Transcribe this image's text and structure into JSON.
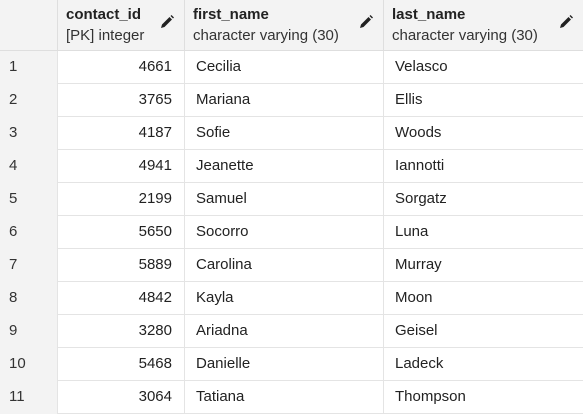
{
  "columns": [
    {
      "name": "contact_id",
      "type": "[PK] integer"
    },
    {
      "name": "first_name",
      "type": "character varying (30)"
    },
    {
      "name": "last_name",
      "type": "character varying (30)"
    }
  ],
  "rows": [
    {
      "num": "1",
      "contact_id": "4661",
      "first_name": "Cecilia",
      "last_name": "Velasco"
    },
    {
      "num": "2",
      "contact_id": "3765",
      "first_name": "Mariana",
      "last_name": "Ellis"
    },
    {
      "num": "3",
      "contact_id": "4187",
      "first_name": "Sofie",
      "last_name": "Woods"
    },
    {
      "num": "4",
      "contact_id": "4941",
      "first_name": "Jeanette",
      "last_name": "Iannotti"
    },
    {
      "num": "5",
      "contact_id": "2199",
      "first_name": "Samuel",
      "last_name": "Sorgatz"
    },
    {
      "num": "6",
      "contact_id": "5650",
      "first_name": "Socorro",
      "last_name": "Luna"
    },
    {
      "num": "7",
      "contact_id": "5889",
      "first_name": "Carolina",
      "last_name": "Murray"
    },
    {
      "num": "8",
      "contact_id": "4842",
      "first_name": "Kayla",
      "last_name": "Moon"
    },
    {
      "num": "9",
      "contact_id": "3280",
      "first_name": "Ariadna",
      "last_name": "Geisel"
    },
    {
      "num": "10",
      "contact_id": "5468",
      "first_name": "Danielle",
      "last_name": "Ladeck"
    },
    {
      "num": "11",
      "contact_id": "3064",
      "first_name": "Tatiana",
      "last_name": "Thompson"
    }
  ],
  "icons": {
    "edit": "pencil-icon"
  }
}
